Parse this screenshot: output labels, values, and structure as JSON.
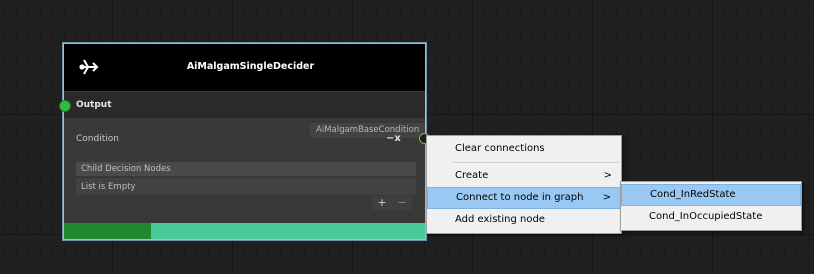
{
  "node": {
    "title": "AiMalgamSingleDecider",
    "icon": "share-arrow-icon",
    "output_label": "Output",
    "condition_label": "Condition",
    "condition_type": "AiMalgamBaseCondition",
    "condition_clear": "−x",
    "child_list_header": "Child Decision Nodes",
    "child_list_empty": "List is Empty",
    "add_label": "+",
    "remove_label": "−",
    "progress": 0.24,
    "colors": {
      "progress_fill": "#22882f",
      "progress_track": "#48c99a",
      "output_port": "#2fbf3b"
    }
  },
  "context_menu": {
    "items": [
      {
        "label": "Clear connections"
      },
      {
        "label": "Create",
        "arrow": ">"
      },
      {
        "label": "Connect to node in graph",
        "arrow": ">"
      },
      {
        "label": "Add existing node"
      }
    ]
  },
  "submenu": {
    "items": [
      {
        "label": "Cond_InRedState"
      },
      {
        "label": "Cond_InOccupiedState"
      }
    ]
  }
}
